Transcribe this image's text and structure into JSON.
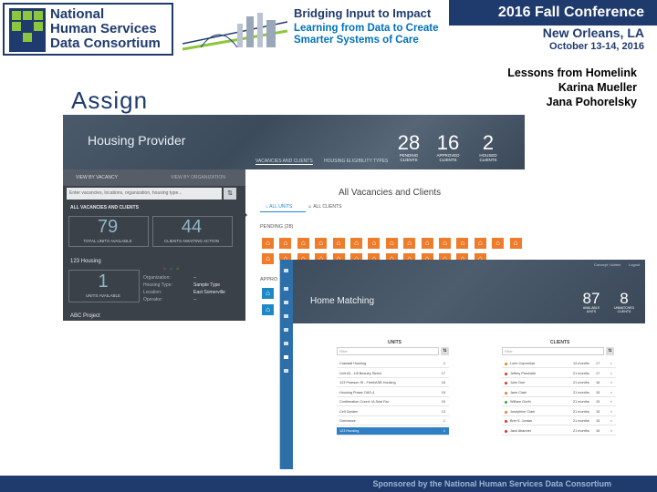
{
  "banner": {
    "logo_lines": [
      "National",
      "Human Services",
      "Data Consortium"
    ],
    "logo_abbr": "NHSDC",
    "tagline_title": "Bridging Input to Impact",
    "tagline_sub1": "Learning from Data to Create",
    "tagline_sub2": "Smarter Systems of Care",
    "conference": "2016 Fall Conference",
    "city": "New Orleans, LA",
    "dates": "October 13-14, 2016",
    "colors": {
      "navy": "#1f3b6e",
      "green": "#8cc63f",
      "blue": "#0072bc"
    }
  },
  "slide": {
    "title": "Assign",
    "lessons_title": "Lessons from Homelink",
    "presenter_1": "Karina Mueller",
    "presenter_2": "Jana Pohorelsky"
  },
  "shot1": {
    "title": "Housing Provider",
    "stats": [
      {
        "n": "28",
        "l1": "PENDING",
        "l2": "CLIENTS"
      },
      {
        "n": "16",
        "l1": "APPROVED",
        "l2": "CLIENTS"
      },
      {
        "n": "2",
        "l1": "HOUSED",
        "l2": "CLIENTS"
      }
    ],
    "tabs": [
      "VACANCIES AND CLIENTS",
      "HOUSING ELIGIBILITY TYPES"
    ],
    "side_tabs": [
      "VIEW BY VACANCY",
      "VIEW BY ORGANIZATION"
    ],
    "search_placeholder": "Enter vacancies, locations, organization, housing type...",
    "search_btn": "⇅",
    "summary_label": "ALL VACANCIES AND CLIENTS",
    "total_units": "79",
    "total_units_label": "TOTAL UNITS AVAILABLE",
    "clients_awaiting": "44",
    "clients_awaiting_label": "CLIENTS AWAITING ACTION",
    "project_name": "123 Housing",
    "units_available": "1",
    "units_available_label": "UNITS AVAILABLE",
    "details": [
      {
        "k": "Organization:",
        "v": "--"
      },
      {
        "k": "Housing Type:",
        "v": "Sample Type"
      },
      {
        "k": "Location:",
        "v": "East Somerville"
      },
      {
        "k": "Operator:",
        "v": "--"
      }
    ],
    "next_project": "ABC Project",
    "main_title": "All Vacancies and Clients",
    "subtabs": [
      "ALL UNITS",
      "ALL CLIENTS"
    ],
    "pending_label": "PENDING (28)",
    "approved_label": "APPRO",
    "house_icon": "house-icon"
  },
  "shot2": {
    "title": "Home Matching",
    "top_links": [
      "Concept / Admin",
      "Logout"
    ],
    "stats": [
      {
        "n": "87",
        "l1": "AVAILABLE",
        "l2": "UNITS"
      },
      {
        "n": "8",
        "l1": "UNMATCHED",
        "l2": "CLIENTS"
      }
    ],
    "units_header": "UNITS",
    "clients_header": "CLIENTS",
    "filter_placeholder": "Filter",
    "filter_btn": "⇅",
    "units": [
      {
        "name": "Crandall Housing",
        "count": "2"
      },
      {
        "name": "Unit #3 - 1/8 Beaulry Street",
        "count": "17"
      },
      {
        "name": "123 Pearson St - Fleet/ASB Housing",
        "count": "16"
      },
      {
        "name": "Housing Phase OAS-4",
        "count": "15"
      },
      {
        "name": "Confirmation Coord: IA Seal Fac",
        "count": "15"
      },
      {
        "name": "Cell Garden",
        "count": "13"
      },
      {
        "name": "Gormance",
        "count": "1"
      },
      {
        "name": "123 Housing",
        "count": "1"
      }
    ],
    "clients": [
      {
        "name": "Lorin Cuprenkar",
        "when": "14 months",
        "n": "17",
        "color": "#ef7c2a"
      },
      {
        "name": "Jeffrey Preshstle",
        "when": "21 months",
        "n": "17",
        "color": "#d9322b"
      },
      {
        "name": "John Doe",
        "when": "21 months",
        "n": "16",
        "color": "#d9322b"
      },
      {
        "name": "Jane Clark",
        "when": "21 months",
        "n": "15",
        "color": "#ef7c2a"
      },
      {
        "name": "William Gorth",
        "when": "21 months",
        "n": "15",
        "color": "#2aa84a"
      },
      {
        "name": "Josephine Clark",
        "when": "21 months",
        "n": "15",
        "color": "#ef7c2a"
      },
      {
        "name": "Bret S. Jordan",
        "when": "21 months",
        "n": "15",
        "color": "#d9322b"
      },
      {
        "name": "Jack Abanner",
        "when": "21 months",
        "n": "16",
        "color": "#d9322b"
      }
    ]
  },
  "footer": {
    "text": "Sponsored by the National Human Services Data Consortium"
  }
}
